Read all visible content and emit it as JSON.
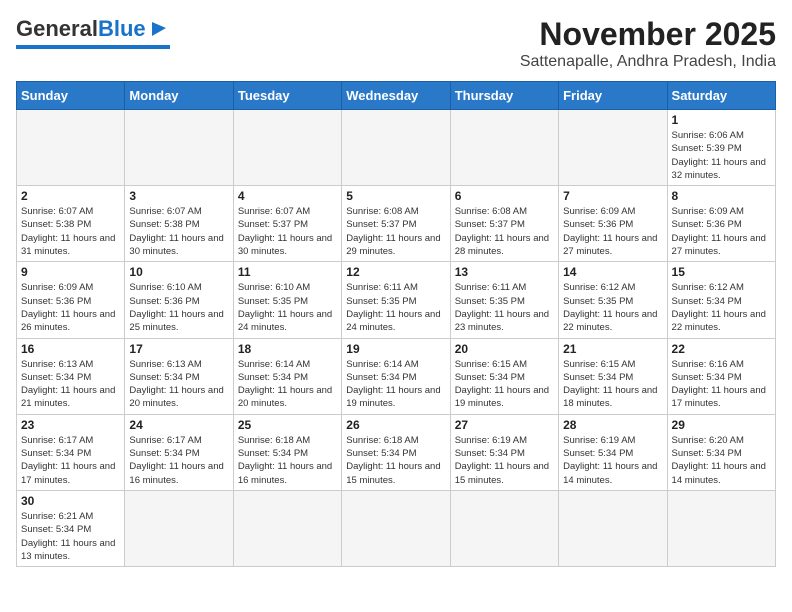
{
  "header": {
    "logo_text_general": "General",
    "logo_text_blue": "Blue",
    "month_title": "November 2025",
    "location": "Sattenapalle, Andhra Pradesh, India"
  },
  "weekdays": [
    "Sunday",
    "Monday",
    "Tuesday",
    "Wednesday",
    "Thursday",
    "Friday",
    "Saturday"
  ],
  "weeks": [
    [
      {
        "day": "",
        "empty": true
      },
      {
        "day": "",
        "empty": true
      },
      {
        "day": "",
        "empty": true
      },
      {
        "day": "",
        "empty": true
      },
      {
        "day": "",
        "empty": true
      },
      {
        "day": "",
        "empty": true
      },
      {
        "day": "1",
        "sunrise": "6:06 AM",
        "sunset": "5:39 PM",
        "daylight": "11 hours and 32 minutes."
      }
    ],
    [
      {
        "day": "2",
        "sunrise": "6:07 AM",
        "sunset": "5:38 PM",
        "daylight": "11 hours and 31 minutes."
      },
      {
        "day": "3",
        "sunrise": "6:07 AM",
        "sunset": "5:38 PM",
        "daylight": "11 hours and 30 minutes."
      },
      {
        "day": "4",
        "sunrise": "6:07 AM",
        "sunset": "5:37 PM",
        "daylight": "11 hours and 30 minutes."
      },
      {
        "day": "5",
        "sunrise": "6:08 AM",
        "sunset": "5:37 PM",
        "daylight": "11 hours and 29 minutes."
      },
      {
        "day": "6",
        "sunrise": "6:08 AM",
        "sunset": "5:37 PM",
        "daylight": "11 hours and 28 minutes."
      },
      {
        "day": "7",
        "sunrise": "6:09 AM",
        "sunset": "5:36 PM",
        "daylight": "11 hours and 27 minutes."
      },
      {
        "day": "8",
        "sunrise": "6:09 AM",
        "sunset": "5:36 PM",
        "daylight": "11 hours and 27 minutes."
      }
    ],
    [
      {
        "day": "9",
        "sunrise": "6:09 AM",
        "sunset": "5:36 PM",
        "daylight": "11 hours and 26 minutes."
      },
      {
        "day": "10",
        "sunrise": "6:10 AM",
        "sunset": "5:36 PM",
        "daylight": "11 hours and 25 minutes."
      },
      {
        "day": "11",
        "sunrise": "6:10 AM",
        "sunset": "5:35 PM",
        "daylight": "11 hours and 24 minutes."
      },
      {
        "day": "12",
        "sunrise": "6:11 AM",
        "sunset": "5:35 PM",
        "daylight": "11 hours and 24 minutes."
      },
      {
        "day": "13",
        "sunrise": "6:11 AM",
        "sunset": "5:35 PM",
        "daylight": "11 hours and 23 minutes."
      },
      {
        "day": "14",
        "sunrise": "6:12 AM",
        "sunset": "5:35 PM",
        "daylight": "11 hours and 22 minutes."
      },
      {
        "day": "15",
        "sunrise": "6:12 AM",
        "sunset": "5:34 PM",
        "daylight": "11 hours and 22 minutes."
      }
    ],
    [
      {
        "day": "16",
        "sunrise": "6:13 AM",
        "sunset": "5:34 PM",
        "daylight": "11 hours and 21 minutes."
      },
      {
        "day": "17",
        "sunrise": "6:13 AM",
        "sunset": "5:34 PM",
        "daylight": "11 hours and 20 minutes."
      },
      {
        "day": "18",
        "sunrise": "6:14 AM",
        "sunset": "5:34 PM",
        "daylight": "11 hours and 20 minutes."
      },
      {
        "day": "19",
        "sunrise": "6:14 AM",
        "sunset": "5:34 PM",
        "daylight": "11 hours and 19 minutes."
      },
      {
        "day": "20",
        "sunrise": "6:15 AM",
        "sunset": "5:34 PM",
        "daylight": "11 hours and 19 minutes."
      },
      {
        "day": "21",
        "sunrise": "6:15 AM",
        "sunset": "5:34 PM",
        "daylight": "11 hours and 18 minutes."
      },
      {
        "day": "22",
        "sunrise": "6:16 AM",
        "sunset": "5:34 PM",
        "daylight": "11 hours and 17 minutes."
      }
    ],
    [
      {
        "day": "23",
        "sunrise": "6:17 AM",
        "sunset": "5:34 PM",
        "daylight": "11 hours and 17 minutes."
      },
      {
        "day": "24",
        "sunrise": "6:17 AM",
        "sunset": "5:34 PM",
        "daylight": "11 hours and 16 minutes."
      },
      {
        "day": "25",
        "sunrise": "6:18 AM",
        "sunset": "5:34 PM",
        "daylight": "11 hours and 16 minutes."
      },
      {
        "day": "26",
        "sunrise": "6:18 AM",
        "sunset": "5:34 PM",
        "daylight": "11 hours and 15 minutes."
      },
      {
        "day": "27",
        "sunrise": "6:19 AM",
        "sunset": "5:34 PM",
        "daylight": "11 hours and 15 minutes."
      },
      {
        "day": "28",
        "sunrise": "6:19 AM",
        "sunset": "5:34 PM",
        "daylight": "11 hours and 14 minutes."
      },
      {
        "day": "29",
        "sunrise": "6:20 AM",
        "sunset": "5:34 PM",
        "daylight": "11 hours and 14 minutes."
      }
    ],
    [
      {
        "day": "30",
        "sunrise": "6:21 AM",
        "sunset": "5:34 PM",
        "daylight": "11 hours and 13 minutes."
      },
      {
        "day": "",
        "empty": true
      },
      {
        "day": "",
        "empty": true
      },
      {
        "day": "",
        "empty": true
      },
      {
        "day": "",
        "empty": true
      },
      {
        "day": "",
        "empty": true
      },
      {
        "day": "",
        "empty": true
      }
    ]
  ]
}
